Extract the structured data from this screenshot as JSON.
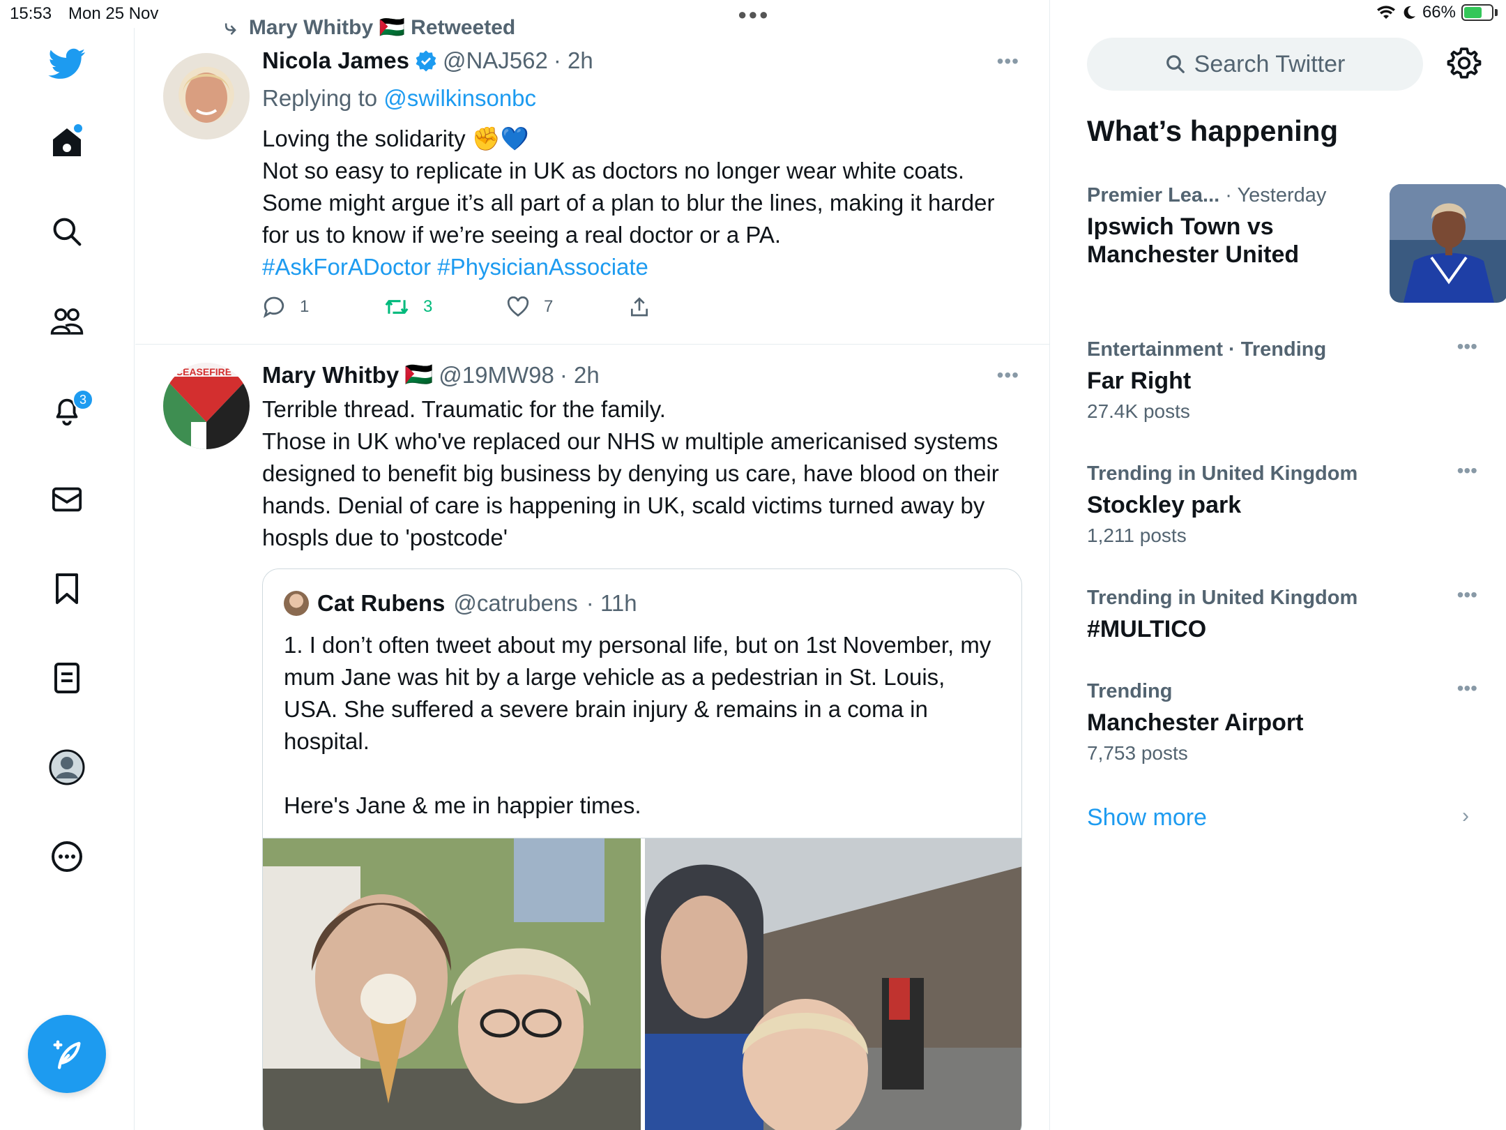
{
  "status_bar": {
    "time": "15:53",
    "date": "Mon 25 Nov",
    "battery": "66%",
    "battery_level": 0.66
  },
  "nav": {
    "notifications_badge": "3",
    "icons": [
      "twitter-logo-icon",
      "home-icon",
      "search-icon",
      "communities-icon",
      "bell-icon",
      "mail-icon",
      "bookmark-icon",
      "lists-icon",
      "profile-icon",
      "more-icon"
    ],
    "compose_icon": "compose-icon"
  },
  "colors": {
    "accent": "#1d9bf0",
    "retweet": "#00ba7c",
    "muted": "#536471"
  },
  "timeline": {
    "retweet_context": "Mary Whitby 🇵🇸 Retweeted",
    "tweet1": {
      "name": "Nicola James",
      "verified": true,
      "handle": "@NAJ562",
      "time": "· 2h",
      "replying_prefix": "Replying to",
      "replying_to": "@swilkinsonbc",
      "line1": "Loving the solidarity ✊💙",
      "text": "Not so easy to replicate in UK as doctors no longer wear white coats. Some might argue it’s all part of a plan to blur the lines, making it harder for us to know if we’re seeing a real doctor or a PA.",
      "hashtags": "#AskForADoctor #PhysicianAssociate",
      "replies": "1",
      "retweets": "3",
      "likes": "7"
    },
    "tweet2": {
      "name": "Mary Whitby",
      "flag": "🇵🇸",
      "handle": "@19MW98",
      "time": "· 2h",
      "line1": "Terrible thread. Traumatic for the family.",
      "text": "Those in UK who've replaced our NHS w multiple americanised systems designed to benefit big business by denying us care, have blood on their hands. Denial of care is happening in UK, scald victims turned away by hospls due to 'postcode'",
      "quote": {
        "name": "Cat Rubens",
        "handle": "@catrubens",
        "time": "· 11h",
        "text1": "1. I don’t often tweet about my personal life, but on 1st November, my mum Jane was hit by a large vehicle as a pedestrian in St. Louis, USA. She suffered a severe brain injury & remains in a coma in hospital.",
        "text2": "Here's Jane & me in happier times."
      }
    }
  },
  "sidebar": {
    "search_placeholder": "Search Twitter",
    "whats_happening": "What’s happening",
    "trends": [
      {
        "meta": "Premier Lea...",
        "meta2": "· Yesterday",
        "title": "Ipswich Town vs Manchester United",
        "count": ""
      },
      {
        "meta": "Entertainment · Trending",
        "title": "Far Right",
        "count": "27.4K posts"
      },
      {
        "meta": "Trending in United Kingdom",
        "title": "Stockley park",
        "count": "1,211 posts"
      },
      {
        "meta": "Trending in United Kingdom",
        "title": "#MULTICO",
        "count": ""
      },
      {
        "meta": "Trending",
        "title": "Manchester Airport",
        "count": "7,753 posts"
      }
    ],
    "show_more": "Show more"
  }
}
